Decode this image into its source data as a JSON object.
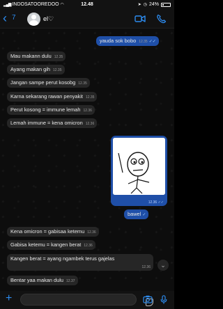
{
  "status_bar": {
    "carrier": "INDOSATOOREDOO",
    "time": "12.48",
    "battery": "24%"
  },
  "header": {
    "back_count": "7",
    "contact_name": "el♡"
  },
  "messages": [
    {
      "dir": "out",
      "text": "yauda sok bobo",
      "time": "12.35"
    },
    {
      "dir": "in",
      "text": "Mau makann dulu",
      "time": "12.35"
    },
    {
      "dir": "in",
      "text": "Ayang makan gih",
      "time": "12.35"
    },
    {
      "dir": "in",
      "text": "Jangan sampe perut kosobg",
      "time": "12.35"
    },
    {
      "dir": "in",
      "text": "Karna sekarang rawan penyakit",
      "time": "12.35"
    },
    {
      "dir": "in",
      "text": "Perut kosong = immune lemah",
      "time": "12.36"
    },
    {
      "dir": "in",
      "text": "Lemah immune = kena omicron",
      "time": "12.36"
    },
    {
      "dir": "out",
      "text": "",
      "time": "12.36"
    },
    {
      "dir": "out",
      "text": "bawel",
      "time": ""
    },
    {
      "dir": "in",
      "text": "Kena omicron = gabisaa ketemu",
      "time": "12.36"
    },
    {
      "dir": "in",
      "text": "Gabisa ketemu = kangen berat",
      "time": "12.36"
    },
    {
      "dir": "in",
      "text": "Kangen berat = ayang ngambek terus gajelas",
      "time": "12.36"
    },
    {
      "dir": "in",
      "text": "Bentar yaa makan dulu",
      "time": "12.37"
    }
  ],
  "icons": {
    "back": "chevron-left-icon",
    "video": "video-call-icon",
    "call": "phone-icon",
    "attach": "plus-icon",
    "sticker": "sticker-icon",
    "camera": "camera-icon",
    "mic": "microphone-icon",
    "scroll": "chevron-down-icon"
  },
  "colors": {
    "accent": "#2d8cf0",
    "outgoing": "#1f4fa8",
    "incoming": "#262626",
    "background": "#0d0d0d"
  }
}
